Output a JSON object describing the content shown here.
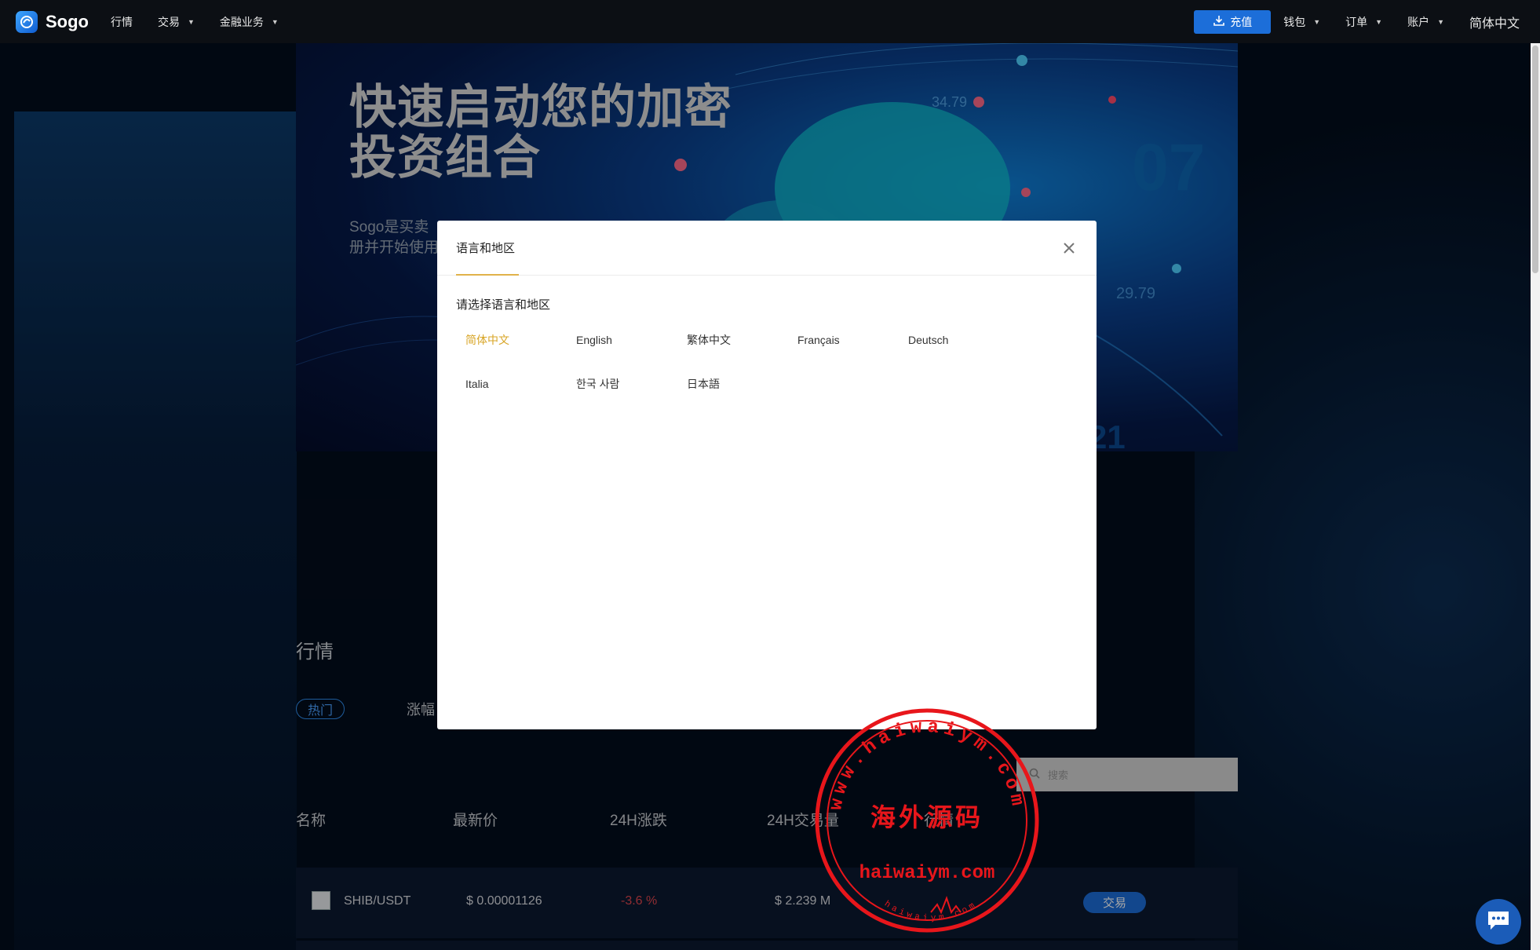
{
  "nav": {
    "brand": "Sogo",
    "left_items": [
      {
        "label": "行情",
        "has_caret": false
      },
      {
        "label": "交易",
        "has_caret": true
      },
      {
        "label": "金融业务",
        "has_caret": true
      }
    ],
    "recharge_label": "充值",
    "right_items": [
      {
        "label": "钱包",
        "has_caret": true
      },
      {
        "label": "订单",
        "has_caret": true
      },
      {
        "label": "账户",
        "has_caret": true
      }
    ],
    "language": "简体中文"
  },
  "banner": {
    "headline_line1": "快速启动您的加密",
    "headline_line2": "投资组合",
    "sub_line1": "Sogo是买卖",
    "sub_line2": "册并开始使用",
    "deco_numbers": [
      "07",
      "29.79",
      "21",
      "34.79"
    ]
  },
  "market": {
    "title": "行情",
    "tab_hot": "热门",
    "tab_gain": "涨幅",
    "search_placeholder": "搜索",
    "columns": [
      "名称",
      "最新价",
      "24H涨跌",
      "24H交易量",
      "行情"
    ],
    "rows": [
      {
        "pair": "SHIB/USDT",
        "price": "$ 0.00001126",
        "change": "-3.6 %",
        "volume": "$ 2.239 M",
        "action": "交易"
      }
    ]
  },
  "modal": {
    "title": "语言和地区",
    "prompt": "请选择语言和地区",
    "languages": [
      "简体中文",
      "English",
      "繁体中文",
      "Français",
      "Deutsch",
      "Italia",
      "한국 사람",
      "日本語"
    ],
    "selected": "简体中文"
  },
  "watermark": {
    "arc_text": "www.haiwaiym.com",
    "center_text": "海外源码",
    "domain": "haiwaiym.com",
    "small_text": "haiwaiym.com"
  },
  "colors": {
    "accent": "#1c6ed9",
    "selected_lang": "#d8a526",
    "negative": "#e0464e",
    "stamp": "#e8161b"
  }
}
